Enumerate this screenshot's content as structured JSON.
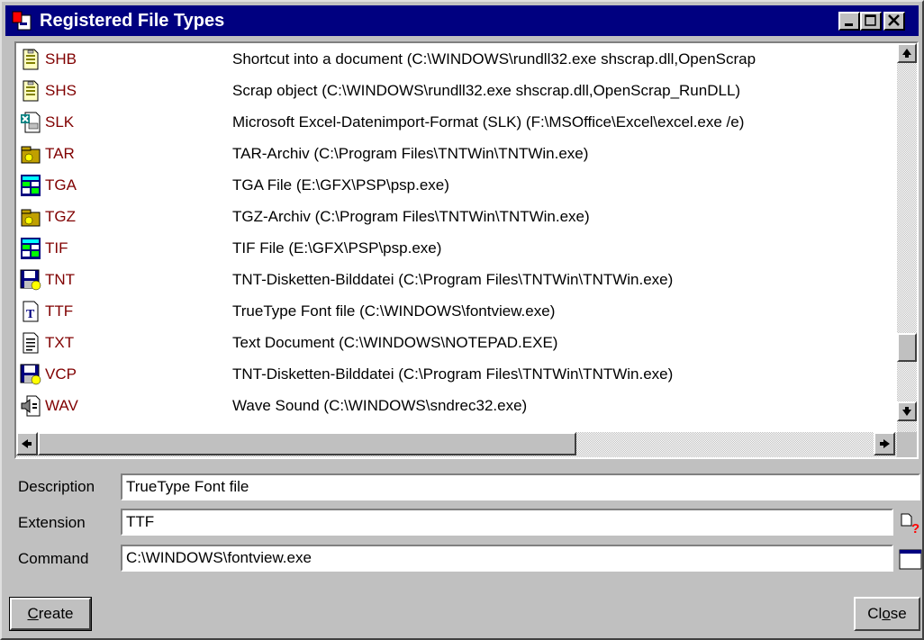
{
  "window": {
    "title": "Registered File Types"
  },
  "file_types": [
    {
      "ext": "SHB",
      "description": "Shortcut into a document (C:\\WINDOWS\\rundll32.exe shscrap.dll,OpenScrap",
      "icon": "document-icon"
    },
    {
      "ext": "SHS",
      "description": "Scrap object (C:\\WINDOWS\\rundll32.exe shscrap.dll,OpenScrap_RunDLL)",
      "icon": "document-icon"
    },
    {
      "ext": "SLK",
      "description": "Microsoft Excel-Datenimport-Format (SLK) (F:\\MSOffice\\Excel\\excel.exe /e)",
      "icon": "excel-document-icon"
    },
    {
      "ext": "TAR",
      "description": "TAR-Archiv (C:\\Program Files\\TNTWin\\TNTWin.exe)",
      "icon": "archive-icon"
    },
    {
      "ext": "TGA",
      "description": "TGA File (E:\\GFX\\PSP\\psp.exe)",
      "icon": "image-file-icon"
    },
    {
      "ext": "TGZ",
      "description": "TGZ-Archiv (C:\\Program Files\\TNTWin\\TNTWin.exe)",
      "icon": "archive-icon"
    },
    {
      "ext": "TIF",
      "description": "TIF File (E:\\GFX\\PSP\\psp.exe)",
      "icon": "image-file-icon"
    },
    {
      "ext": "TNT",
      "description": "TNT-Disketten-Bilddatei (C:\\Program Files\\TNTWin\\TNTWin.exe)",
      "icon": "floppy-disk-icon"
    },
    {
      "ext": "TTF",
      "description": "TrueType Font file (C:\\WINDOWS\\fontview.exe)",
      "icon": "font-file-icon"
    },
    {
      "ext": "TXT",
      "description": "Text Document (C:\\WINDOWS\\NOTEPAD.EXE)",
      "icon": "text-document-icon"
    },
    {
      "ext": "VCP",
      "description": "TNT-Disketten-Bilddatei (C:\\Program Files\\TNTWin\\TNTWin.exe)",
      "icon": "floppy-disk-icon"
    },
    {
      "ext": "WAV",
      "description": "Wave Sound (C:\\WINDOWS\\sndrec32.exe)",
      "icon": "sound-file-icon"
    }
  ],
  "form": {
    "description_label": "Description",
    "description_value": "TrueType Font file",
    "extension_label": "Extension",
    "extension_value": "TTF",
    "command_label": "Command",
    "command_value": "C:\\WINDOWS\\fontview.exe"
  },
  "buttons": {
    "create_label": "Create",
    "create_mnemonic": "C",
    "create_rest": "reate",
    "close_label": "Close",
    "close_prefix": "Cl",
    "close_mnemonic": "o",
    "close_rest": "se"
  },
  "colors": {
    "titlebar": "#000080",
    "extension_text": "#800000",
    "window_face": "#c0c0c0"
  }
}
